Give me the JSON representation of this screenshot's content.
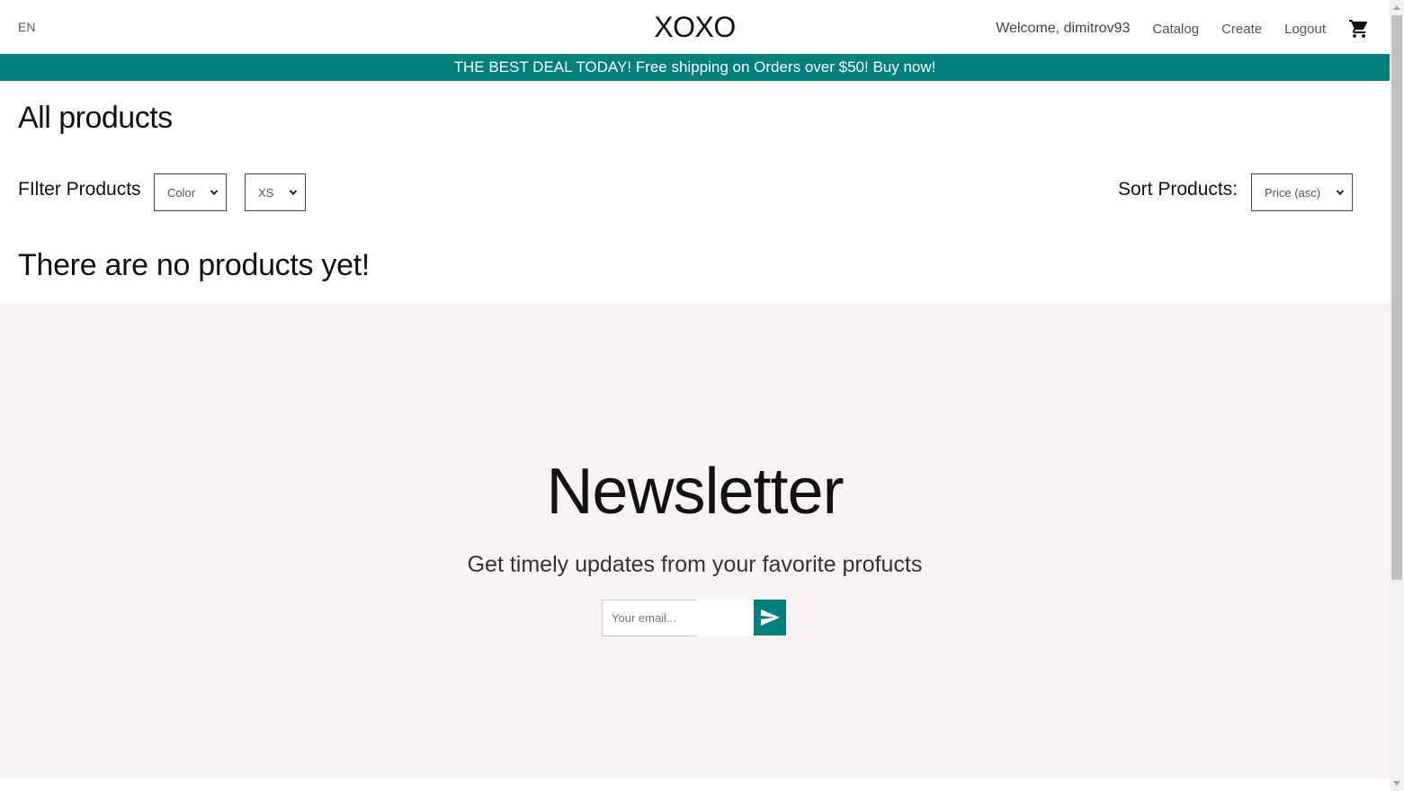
{
  "header": {
    "language": "EN",
    "brand": "XOXO",
    "welcome": "Welcome, dimitrov93",
    "nav": {
      "catalog": "Catalog",
      "create": "Create",
      "logout": "Logout"
    },
    "cart_icon": "shopping-cart-icon"
  },
  "promo": {
    "text": "THE BEST DEAL TODAY! Free shipping on Orders over $50! Buy now!",
    "color": "#007f7c"
  },
  "main": {
    "title": "All products",
    "filter_label": "FIlter Products",
    "filters": {
      "color_selected": "Color",
      "size_selected": "XS"
    },
    "sort_label": "Sort Products:",
    "sort_selected": "Price (asc)",
    "empty_message": "There are no products yet!"
  },
  "newsletter": {
    "title": "Newsletter",
    "subtitle": "Get timely updates from your favorite profucts",
    "email_placeholder": "Your email...",
    "submit_icon": "send-icon",
    "background": "#f8f3f2",
    "button_color": "#007f7c"
  }
}
